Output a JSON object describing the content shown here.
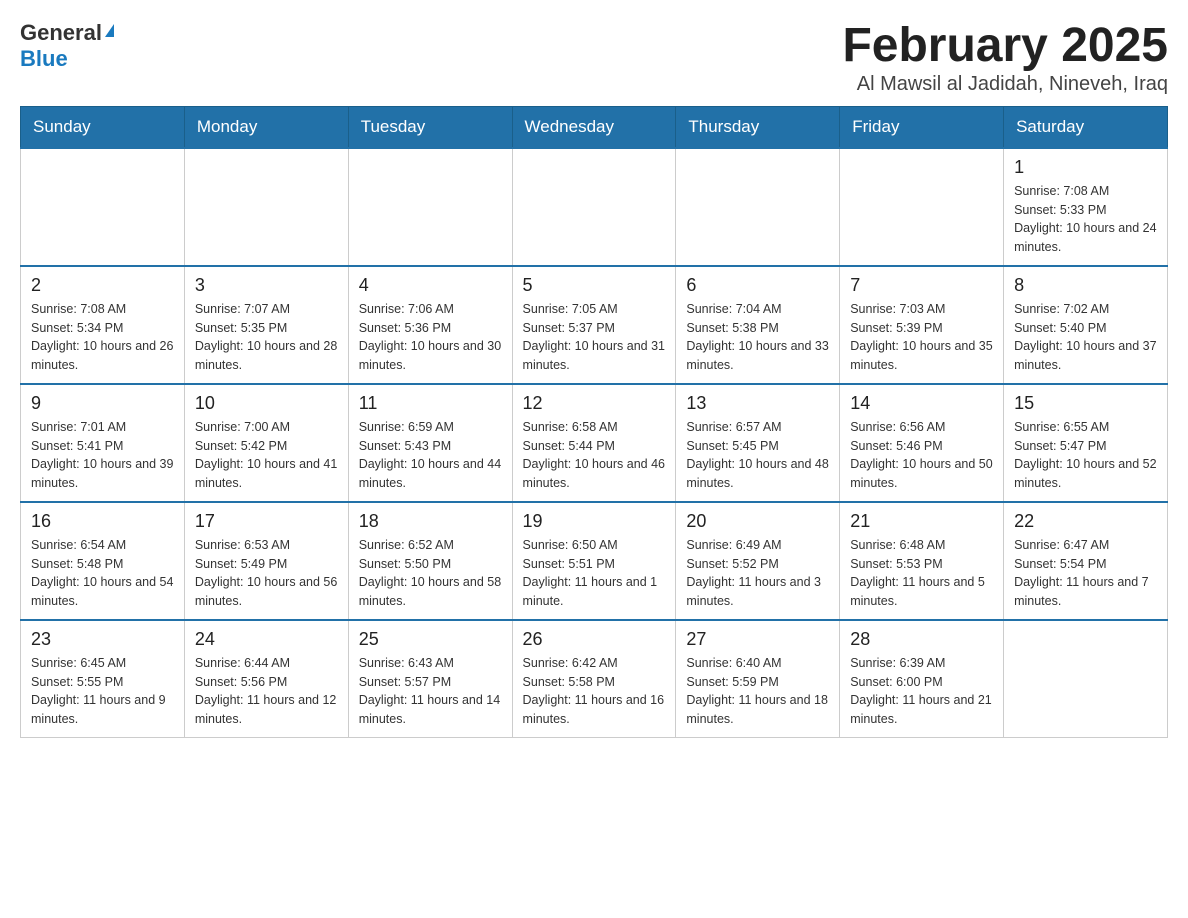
{
  "logo": {
    "general": "General",
    "blue": "Blue"
  },
  "title": "February 2025",
  "subtitle": "Al Mawsil al Jadidah, Nineveh, Iraq",
  "days_of_week": [
    "Sunday",
    "Monday",
    "Tuesday",
    "Wednesday",
    "Thursday",
    "Friday",
    "Saturday"
  ],
  "weeks": [
    [
      {
        "day": "",
        "info": ""
      },
      {
        "day": "",
        "info": ""
      },
      {
        "day": "",
        "info": ""
      },
      {
        "day": "",
        "info": ""
      },
      {
        "day": "",
        "info": ""
      },
      {
        "day": "",
        "info": ""
      },
      {
        "day": "1",
        "info": "Sunrise: 7:08 AM\nSunset: 5:33 PM\nDaylight: 10 hours and 24 minutes."
      }
    ],
    [
      {
        "day": "2",
        "info": "Sunrise: 7:08 AM\nSunset: 5:34 PM\nDaylight: 10 hours and 26 minutes."
      },
      {
        "day": "3",
        "info": "Sunrise: 7:07 AM\nSunset: 5:35 PM\nDaylight: 10 hours and 28 minutes."
      },
      {
        "day": "4",
        "info": "Sunrise: 7:06 AM\nSunset: 5:36 PM\nDaylight: 10 hours and 30 minutes."
      },
      {
        "day": "5",
        "info": "Sunrise: 7:05 AM\nSunset: 5:37 PM\nDaylight: 10 hours and 31 minutes."
      },
      {
        "day": "6",
        "info": "Sunrise: 7:04 AM\nSunset: 5:38 PM\nDaylight: 10 hours and 33 minutes."
      },
      {
        "day": "7",
        "info": "Sunrise: 7:03 AM\nSunset: 5:39 PM\nDaylight: 10 hours and 35 minutes."
      },
      {
        "day": "8",
        "info": "Sunrise: 7:02 AM\nSunset: 5:40 PM\nDaylight: 10 hours and 37 minutes."
      }
    ],
    [
      {
        "day": "9",
        "info": "Sunrise: 7:01 AM\nSunset: 5:41 PM\nDaylight: 10 hours and 39 minutes."
      },
      {
        "day": "10",
        "info": "Sunrise: 7:00 AM\nSunset: 5:42 PM\nDaylight: 10 hours and 41 minutes."
      },
      {
        "day": "11",
        "info": "Sunrise: 6:59 AM\nSunset: 5:43 PM\nDaylight: 10 hours and 44 minutes."
      },
      {
        "day": "12",
        "info": "Sunrise: 6:58 AM\nSunset: 5:44 PM\nDaylight: 10 hours and 46 minutes."
      },
      {
        "day": "13",
        "info": "Sunrise: 6:57 AM\nSunset: 5:45 PM\nDaylight: 10 hours and 48 minutes."
      },
      {
        "day": "14",
        "info": "Sunrise: 6:56 AM\nSunset: 5:46 PM\nDaylight: 10 hours and 50 minutes."
      },
      {
        "day": "15",
        "info": "Sunrise: 6:55 AM\nSunset: 5:47 PM\nDaylight: 10 hours and 52 minutes."
      }
    ],
    [
      {
        "day": "16",
        "info": "Sunrise: 6:54 AM\nSunset: 5:48 PM\nDaylight: 10 hours and 54 minutes."
      },
      {
        "day": "17",
        "info": "Sunrise: 6:53 AM\nSunset: 5:49 PM\nDaylight: 10 hours and 56 minutes."
      },
      {
        "day": "18",
        "info": "Sunrise: 6:52 AM\nSunset: 5:50 PM\nDaylight: 10 hours and 58 minutes."
      },
      {
        "day": "19",
        "info": "Sunrise: 6:50 AM\nSunset: 5:51 PM\nDaylight: 11 hours and 1 minute."
      },
      {
        "day": "20",
        "info": "Sunrise: 6:49 AM\nSunset: 5:52 PM\nDaylight: 11 hours and 3 minutes."
      },
      {
        "day": "21",
        "info": "Sunrise: 6:48 AM\nSunset: 5:53 PM\nDaylight: 11 hours and 5 minutes."
      },
      {
        "day": "22",
        "info": "Sunrise: 6:47 AM\nSunset: 5:54 PM\nDaylight: 11 hours and 7 minutes."
      }
    ],
    [
      {
        "day": "23",
        "info": "Sunrise: 6:45 AM\nSunset: 5:55 PM\nDaylight: 11 hours and 9 minutes."
      },
      {
        "day": "24",
        "info": "Sunrise: 6:44 AM\nSunset: 5:56 PM\nDaylight: 11 hours and 12 minutes."
      },
      {
        "day": "25",
        "info": "Sunrise: 6:43 AM\nSunset: 5:57 PM\nDaylight: 11 hours and 14 minutes."
      },
      {
        "day": "26",
        "info": "Sunrise: 6:42 AM\nSunset: 5:58 PM\nDaylight: 11 hours and 16 minutes."
      },
      {
        "day": "27",
        "info": "Sunrise: 6:40 AM\nSunset: 5:59 PM\nDaylight: 11 hours and 18 minutes."
      },
      {
        "day": "28",
        "info": "Sunrise: 6:39 AM\nSunset: 6:00 PM\nDaylight: 11 hours and 21 minutes."
      },
      {
        "day": "",
        "info": ""
      }
    ]
  ]
}
